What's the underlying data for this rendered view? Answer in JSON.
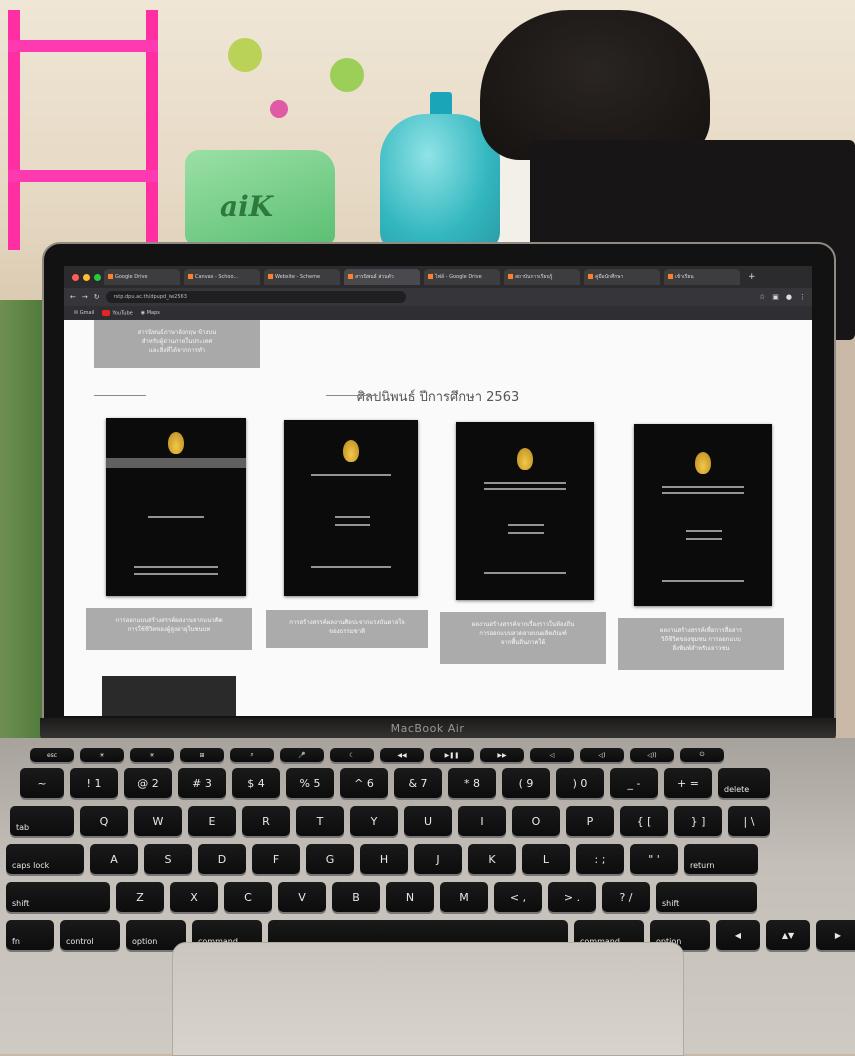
{
  "browser": {
    "tabs": [
      {
        "label": "Google Drive"
      },
      {
        "label": "Canvas - Schoo..."
      },
      {
        "label": "Website - Scheme"
      },
      {
        "label": "สารนิพนธ์ ส่วนตัว"
      },
      {
        "label": "ไฟล์ - Google Drive"
      },
      {
        "label": "สถาบันการเรียนรู้"
      },
      {
        "label": "คู่มือนักศึกษา"
      },
      {
        "label": "เข้าเรียน"
      }
    ],
    "url": "rstp.dpu.ac.th/dpupd_iw2563",
    "bookmarks": [
      {
        "label": "Gmail"
      },
      {
        "label": "YouTube"
      },
      {
        "label": "Maps"
      }
    ]
  },
  "page": {
    "top_caption": "สารนิพนธ์ภาษาอังกฤษ ข้างบน\nสำหรับผู้อ่านภายในประเทศ\nและสิ่งที่ได้จากการทำ",
    "section_title": "ศิลปนิพนธ์ ปีการศึกษา 2563",
    "cards": [
      {
        "caption": "การออกแบบสร้างสรรค์ผลงานจากแนวคิด\nการใช้ชีวิตของผู้สูงอายุในชนบท"
      },
      {
        "caption": "การสร้างสรรค์ผลงานศิลปะจากแรงบันดาลใจ\nของธรรมชาติ"
      },
      {
        "caption": "ผลงานสร้างสรรค์จากเรื่องราวในท้องถิ่น\nการออกแบบลวดลายบนผลิตภัณฑ์\nจากพื้นถิ่นภาคใต้"
      },
      {
        "caption": "ผลงานสร้างสรรค์เพื่อการสื่อสาร\nวิถีชีวิตของชุมชน การออกแบบ\nสิ่งพิมพ์สำหรับเยาวชน"
      }
    ]
  },
  "laptop": {
    "brand": "MacBook Air"
  },
  "keyboard": {
    "row_num": [
      "~",
      "! 1",
      "@ 2",
      "# 3",
      "$ 4",
      "% 5",
      "^ 6",
      "& 7",
      "* 8",
      "( 9",
      ") 0",
      "_ -",
      "+ =",
      "delete"
    ],
    "row_q": [
      "tab",
      "Q",
      "W",
      "E",
      "R",
      "T",
      "Y",
      "U",
      "I",
      "O",
      "P",
      "{ [",
      "} ]",
      "| \\"
    ],
    "row_a": [
      "caps lock",
      "A",
      "S",
      "D",
      "F",
      "G",
      "H",
      "J",
      "K",
      "L",
      ": ;",
      "\" '",
      "return"
    ],
    "row_z": [
      "shift",
      "Z",
      "X",
      "C",
      "V",
      "B",
      "N",
      "M",
      "< ,",
      "> .",
      "? /",
      "shift"
    ],
    "row_mod": [
      "fn",
      "control",
      "option",
      "command",
      "",
      "command",
      "option",
      "◀",
      "▲▼",
      "▶"
    ]
  },
  "colors": {
    "shelf": "#ff2fa3",
    "bottle": "#33b7bf",
    "screen_bg": "#fafafa",
    "caption_box": "#ababab",
    "emblem_gold": "#d9a42e"
  }
}
